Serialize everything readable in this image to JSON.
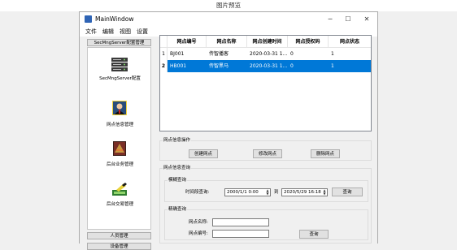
{
  "outer": {
    "title": "图片预览"
  },
  "window": {
    "title": "MainWindow",
    "controls": {
      "minimize": "─",
      "maximize": "☐",
      "close": "✕"
    }
  },
  "menu": [
    "文件",
    "编辑",
    "视图",
    "设置"
  ],
  "nav": {
    "top_button": "SecMngServer配置管理",
    "items": [
      {
        "label": "SecMngServer配置",
        "icon": "server-icon"
      },
      {
        "label": "网点信息管理",
        "icon": "person-icon"
      },
      {
        "label": "后台业务管理",
        "icon": "business-icon"
      },
      {
        "label": "后台交易管理",
        "icon": "transaction-icon"
      }
    ],
    "bottom_buttons": [
      "人员管理",
      "设备管理"
    ]
  },
  "table": {
    "columns": [
      "网点编号",
      "网点名称",
      "网点创建时间",
      "网点授权码",
      "网点状态"
    ],
    "rows": [
      {
        "index": "1",
        "cells": [
          "BJ001",
          "传智播客",
          "2020-03-31 1...",
          "0",
          "1"
        ],
        "selected": false
      },
      {
        "index": "2",
        "cells": [
          "HB001",
          "传智黑马",
          "2020-03-31 1...",
          "0",
          "1"
        ],
        "selected": true
      }
    ]
  },
  "ops": {
    "label": "网点信息操作",
    "create": "创建网点",
    "modify": "修改网点",
    "delete": "删除网点"
  },
  "query": {
    "label": "网点信息查询",
    "fuzzy": {
      "label": "模糊查询",
      "time_label": "时间段查询:",
      "from": "2000/1/1 0:00",
      "to_label": "到",
      "to": "2020/5/29 16:18",
      "button": "查询"
    },
    "exact": {
      "label": "精确查询",
      "name_label": "网点名称:",
      "name_value": "",
      "id_label": "网点编号:",
      "id_value": "",
      "button": "查询"
    }
  },
  "colors": {
    "selection": "#0078d7"
  }
}
